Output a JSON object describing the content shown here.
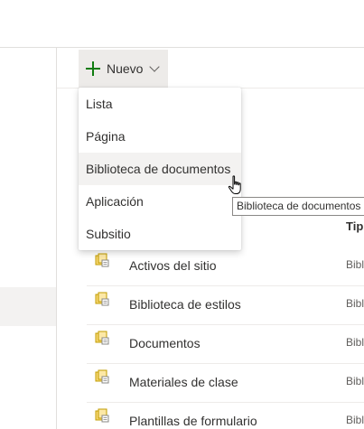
{
  "command_bar": {
    "new_label": "Nuevo",
    "new_icon": "plus-icon",
    "dropdown_icon": "chevron-down-icon"
  },
  "new_menu": {
    "items": [
      {
        "label": "Lista"
      },
      {
        "label": "Página"
      },
      {
        "label": "Biblioteca de documentos",
        "hovered": true
      },
      {
        "label": "Aplicación"
      },
      {
        "label": "Subsitio"
      }
    ]
  },
  "tooltip": {
    "text": "Biblioteca de documentos"
  },
  "list": {
    "column_type_header": "Tip",
    "rows": [
      {
        "name": "Activos del sitio",
        "type": "Bibl",
        "icon": "document-library-icon"
      },
      {
        "name": "Biblioteca de estilos",
        "type": "Bibl",
        "icon": "document-library-icon"
      },
      {
        "name": "Documentos",
        "type": "Bibl",
        "icon": "document-library-icon"
      },
      {
        "name": "Materiales de clase",
        "type": "Bibl",
        "icon": "document-library-icon"
      },
      {
        "name": "Plantillas de formulario",
        "type": "Bibl",
        "icon": "document-library-icon"
      }
    ]
  },
  "colors": {
    "accent_green": "#107c10",
    "library_icon": "#c19c00",
    "hover_bg": "#f3f2f1"
  }
}
